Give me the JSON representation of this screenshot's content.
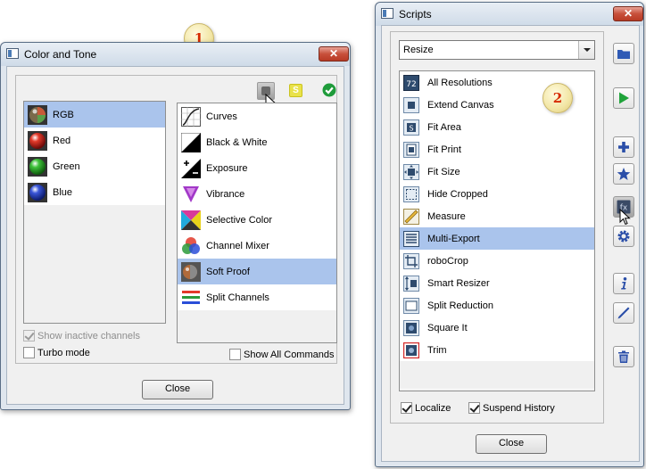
{
  "callouts": {
    "first": "1",
    "second": "2"
  },
  "color_tone": {
    "title": "Color and Tone",
    "close_glyph": "✕",
    "channels": [
      {
        "label": "RGB",
        "icon": "rgb-sphere-icon",
        "selected": true
      },
      {
        "label": "Red",
        "icon": "red-sphere-icon",
        "selected": false
      },
      {
        "label": "Green",
        "icon": "green-sphere-icon",
        "selected": false
      },
      {
        "label": "Blue",
        "icon": "blue-sphere-icon",
        "selected": false
      }
    ],
    "commands": [
      {
        "label": "Curves",
        "icon": "curves-icon",
        "selected": false
      },
      {
        "label": "Black & White",
        "icon": "black-white-icon",
        "selected": false
      },
      {
        "label": "Exposure",
        "icon": "exposure-icon",
        "selected": false
      },
      {
        "label": "Vibrance",
        "icon": "vibrance-icon",
        "selected": false
      },
      {
        "label": "Selective Color",
        "icon": "selective-color-icon",
        "selected": false
      },
      {
        "label": "Channel Mixer",
        "icon": "channel-mixer-icon",
        "selected": false
      },
      {
        "label": "Soft Proof",
        "icon": "soft-proof-icon",
        "selected": true
      },
      {
        "label": "Split Channels",
        "icon": "split-channels-icon",
        "selected": false
      }
    ],
    "toolbar": {
      "s_badge": "S"
    },
    "show_inactive_label": "Show inactive channels",
    "show_inactive_checked": true,
    "turbo_label": "Turbo mode",
    "turbo_checked": false,
    "show_all_label": "Show All Commands",
    "show_all_checked": false,
    "close_label": "Close"
  },
  "scripts": {
    "title": "Scripts",
    "close_glyph": "✕",
    "category": "Resize",
    "items": [
      {
        "label": "All Resolutions",
        "icon": "all-resolutions-icon",
        "selected": false
      },
      {
        "label": "Extend Canvas",
        "icon": "extend-canvas-icon",
        "selected": false
      },
      {
        "label": "Fit Area",
        "icon": "fit-area-icon",
        "selected": false
      },
      {
        "label": "Fit Print",
        "icon": "fit-print-icon",
        "selected": false
      },
      {
        "label": "Fit Size",
        "icon": "fit-size-icon",
        "selected": false
      },
      {
        "label": "Hide Cropped",
        "icon": "hide-cropped-icon",
        "selected": false
      },
      {
        "label": "Measure",
        "icon": "measure-icon",
        "selected": false
      },
      {
        "label": "Multi-Export",
        "icon": "multi-export-icon",
        "selected": true
      },
      {
        "label": "roboCrop",
        "icon": "robocrop-icon",
        "selected": false
      },
      {
        "label": "Smart Resizer",
        "icon": "smart-resizer-icon",
        "selected": false
      },
      {
        "label": "Split Reduction",
        "icon": "split-reduction-icon",
        "selected": false
      },
      {
        "label": "Square It",
        "icon": "square-it-icon",
        "selected": false
      },
      {
        "label": "Trim",
        "icon": "trim-icon",
        "selected": false
      }
    ],
    "all_res_glyph": "72",
    "fit_area_glyph": "S",
    "fx_glyph": "fx",
    "localize_label": "Localize",
    "localize_checked": true,
    "suspend_label": "Suspend History",
    "suspend_checked": true,
    "close_label": "Close",
    "side_buttons": [
      "folder-icon",
      "play-icon",
      "plus-icon",
      "star-icon",
      "fx-icon",
      "gear-icon",
      "info-icon",
      "pencil-icon",
      "trash-icon"
    ]
  },
  "colors": {
    "selection": "#aac4ec",
    "title_bar": "#d6e0ec",
    "close_red": "#c8503b",
    "badge_text": "#d62a00",
    "play_green": "#1fa33a",
    "icon_blue": "#2a4ea8"
  }
}
